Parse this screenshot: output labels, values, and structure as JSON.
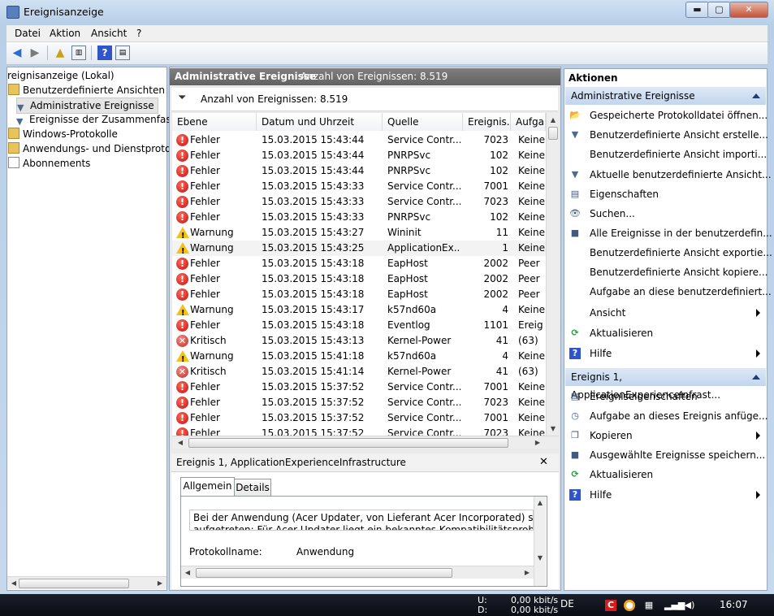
{
  "window": {
    "title": "Ereignisanzeige",
    "minimize": "▬",
    "maximize": "▢",
    "close": "✕"
  },
  "menu": [
    "Datei",
    "Aktion",
    "Ansicht",
    "?"
  ],
  "tree": [
    {
      "label": "reignisanzeige (Lokal)",
      "icon": "computer-icon"
    },
    {
      "label": "Benutzerdefinierte Ansichten",
      "icon": "folder-icon"
    },
    {
      "label": "Administrative Ereignisse",
      "icon": "filter-icon"
    },
    {
      "label": "Ereignisse der Zusammenfassu",
      "icon": "filter-icon"
    },
    {
      "label": "Windows-Protokolle",
      "icon": "folder-icon"
    },
    {
      "label": "Anwendungs- und Dienstprotokol",
      "icon": "folder-icon"
    },
    {
      "label": "Abonnements",
      "icon": "subscription-icon"
    }
  ],
  "middle": {
    "header_title": "Administrative Ereignisse",
    "header_count": "Anzahl von Ereignissen: 8.519",
    "filter_text": "Anzahl von Ereignissen: 8.519",
    "columns": [
      "Ebene",
      "Datum und Uhrzeit",
      "Quelle",
      "Ereignis...",
      "Aufga"
    ],
    "rows": [
      {
        "level": "Fehler",
        "type": "err",
        "date": "15.03.2015 15:43:44",
        "source": "Service Contr...",
        "id": "7023",
        "task": "Keine"
      },
      {
        "level": "Fehler",
        "type": "err",
        "date": "15.03.2015 15:43:44",
        "source": "PNRPSvc",
        "id": "102",
        "task": "Keine"
      },
      {
        "level": "Fehler",
        "type": "err",
        "date": "15.03.2015 15:43:44",
        "source": "PNRPSvc",
        "id": "102",
        "task": "Keine"
      },
      {
        "level": "Fehler",
        "type": "err",
        "date": "15.03.2015 15:43:33",
        "source": "Service Contr...",
        "id": "7001",
        "task": "Keine"
      },
      {
        "level": "Fehler",
        "type": "err",
        "date": "15.03.2015 15:43:33",
        "source": "Service Contr...",
        "id": "7023",
        "task": "Keine"
      },
      {
        "level": "Fehler",
        "type": "err",
        "date": "15.03.2015 15:43:33",
        "source": "PNRPSvc",
        "id": "102",
        "task": "Keine"
      },
      {
        "level": "Warnung",
        "type": "warn",
        "date": "15.03.2015 15:43:27",
        "source": "Wininit",
        "id": "11",
        "task": "Keine"
      },
      {
        "level": "Warnung",
        "type": "warn",
        "date": "15.03.2015 15:43:25",
        "source": "ApplicationEx...",
        "id": "1",
        "task": "Keine"
      },
      {
        "level": "Fehler",
        "type": "err",
        "date": "15.03.2015 15:43:18",
        "source": "EapHost",
        "id": "2002",
        "task": "Peer"
      },
      {
        "level": "Fehler",
        "type": "err",
        "date": "15.03.2015 15:43:18",
        "source": "EapHost",
        "id": "2002",
        "task": "Peer"
      },
      {
        "level": "Fehler",
        "type": "err",
        "date": "15.03.2015 15:43:18",
        "source": "EapHost",
        "id": "2002",
        "task": "Peer"
      },
      {
        "level": "Warnung",
        "type": "warn",
        "date": "15.03.2015 15:43:17",
        "source": "k57nd60a",
        "id": "4",
        "task": "Keine"
      },
      {
        "level": "Fehler",
        "type": "err",
        "date": "15.03.2015 15:43:18",
        "source": "Eventlog",
        "id": "1101",
        "task": "Ereig"
      },
      {
        "level": "Kritisch",
        "type": "crit",
        "date": "15.03.2015 15:43:13",
        "source": "Kernel-Power",
        "id": "41",
        "task": "(63)"
      },
      {
        "level": "Warnung",
        "type": "warn",
        "date": "15.03.2015 15:41:18",
        "source": "k57nd60a",
        "id": "4",
        "task": "Keine"
      },
      {
        "level": "Kritisch",
        "type": "crit",
        "date": "15.03.2015 15:41:14",
        "source": "Kernel-Power",
        "id": "41",
        "task": "(63)"
      },
      {
        "level": "Fehler",
        "type": "err",
        "date": "15.03.2015 15:37:52",
        "source": "Service Contr...",
        "id": "7001",
        "task": "Keine"
      },
      {
        "level": "Fehler",
        "type": "err",
        "date": "15.03.2015 15:37:52",
        "source": "Service Contr...",
        "id": "7023",
        "task": "Keine"
      },
      {
        "level": "Fehler",
        "type": "err",
        "date": "15.03.2015 15:37:52",
        "source": "Service Contr...",
        "id": "7001",
        "task": "Keine"
      },
      {
        "level": "Fehler",
        "type": "err",
        "date": "15.03.2015 15:37:52",
        "source": "Service Contr...",
        "id": "7023",
        "task": "Keine"
      }
    ],
    "selected_row": 7
  },
  "detail": {
    "title": "Ereignis 1, ApplicationExperienceInfrastructure",
    "close": "✕",
    "tabs": [
      "Allgemein",
      "Details"
    ],
    "line1": "Bei der Anwendung (Acer Updater, von Lieferant Acer Incorporated) sind folgen",
    "line2": "aufgetreten: Für Acer Updater liegt ein bekanntes Kompatibilitätsproblem mit di",
    "field_label": "Protokollname:",
    "field_value": "Anwendung"
  },
  "actions": {
    "title": "Aktionen",
    "section1": "Administrative Ereignisse",
    "items1": [
      {
        "label": "Gespeicherte Protokolldatei öffnen...",
        "icon": "open-folder-icon",
        "glyph": "📂",
        "submenu": false
      },
      {
        "label": "Benutzerdefinierte Ansicht erstelle...",
        "icon": "filter-create-icon",
        "glyph": "▼",
        "submenu": false
      },
      {
        "label": "Benutzerdefinierte Ansicht importi...",
        "icon": "",
        "glyph": "",
        "submenu": false
      },
      {
        "label": "Aktuelle benutzerdefinierte Ansicht...",
        "icon": "filter-icon",
        "glyph": "▼",
        "submenu": false
      },
      {
        "label": "Eigenschaften",
        "icon": "properties-icon",
        "glyph": "▤",
        "submenu": false
      },
      {
        "label": "Suchen...",
        "icon": "binoculars-icon",
        "glyph": "👁",
        "submenu": false
      },
      {
        "label": "Alle Ereignisse in der benutzerdefin...",
        "icon": "save-icon",
        "glyph": "■",
        "submenu": false
      },
      {
        "label": "Benutzerdefinierte Ansicht exportie...",
        "icon": "",
        "glyph": "",
        "submenu": false
      },
      {
        "label": "Benutzerdefinierte Ansicht kopiere...",
        "icon": "",
        "glyph": "",
        "submenu": false
      },
      {
        "label": "Aufgabe an diese benutzerdefiniert...",
        "icon": "",
        "glyph": "",
        "submenu": false
      },
      {
        "label": "Ansicht",
        "icon": "",
        "glyph": "",
        "submenu": true
      },
      {
        "label": "Aktualisieren",
        "icon": "refresh-icon",
        "glyph": "⟳",
        "submenu": false
      },
      {
        "label": "Hilfe",
        "icon": "help-icon",
        "glyph": "?",
        "submenu": true
      }
    ],
    "section2": "Ereignis 1, ApplicationExperienceInfrast...",
    "items2": [
      {
        "label": "Ereigniseigenschaften",
        "icon": "event-properties-icon",
        "glyph": "▤",
        "submenu": false
      },
      {
        "label": "Aufgabe an dieses Ereignis anfüge...",
        "icon": "task-icon",
        "glyph": "◷",
        "submenu": false
      },
      {
        "label": "Kopieren",
        "icon": "copy-icon",
        "glyph": "❐",
        "submenu": true
      },
      {
        "label": "Ausgewählte Ereignisse speichern...",
        "icon": "save-icon",
        "glyph": "■",
        "submenu": false
      },
      {
        "label": "Aktualisieren",
        "icon": "refresh-icon",
        "glyph": "⟳",
        "submenu": false
      },
      {
        "label": "Hilfe",
        "icon": "help-icon",
        "glyph": "?",
        "submenu": true
      }
    ]
  },
  "taskbar": {
    "net_up_label": "U:",
    "net_down_label": "D:",
    "net_up": "0,00 kbit/s",
    "net_down": "0,00 kbit/s",
    "lang": "DE",
    "clock": "16:07"
  }
}
